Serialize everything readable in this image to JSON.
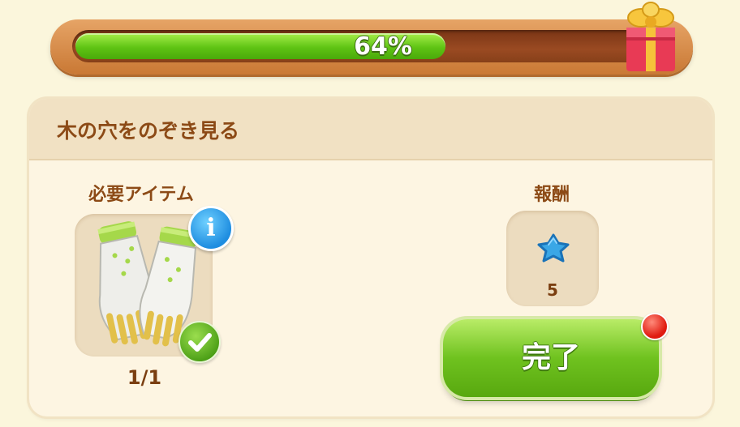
{
  "progress": {
    "label": "64%",
    "fraction": 0.64,
    "fill_color": "#5fc414"
  },
  "quest": {
    "title": "木の穴をのぞき見る"
  },
  "required": {
    "label": "必要アイテム",
    "item_icon": "gardening-gloves-icon",
    "count": "1/1"
  },
  "reward": {
    "label": "報酬",
    "icon": "blue-star-icon",
    "count": "5"
  },
  "actions": {
    "complete_label": "完了",
    "accent_color": "#6fc21f",
    "notification_color": "#e01b10"
  }
}
